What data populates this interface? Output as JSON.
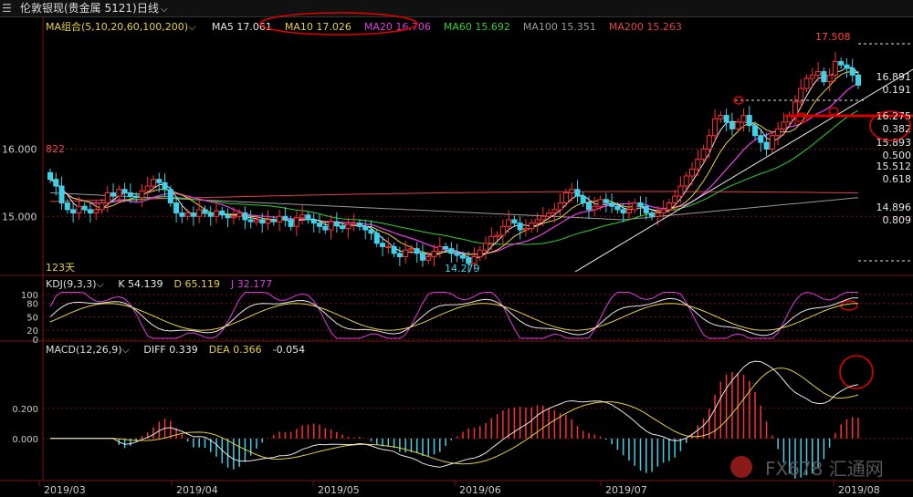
{
  "window": {
    "symbol": "伦敦银现(贵金属 5121)",
    "period": "日线",
    "menu_icon": "menu-lines-icon",
    "dropdown_icon": "chevron-down-icon"
  },
  "ma_bar": {
    "group_label": "MA组合(5,10,20,60,100,200)",
    "items": [
      {
        "label": "MA5 17.061",
        "color": "#e8e8e8"
      },
      {
        "label": "MA10 17.026",
        "color": "#e6d23a"
      },
      {
        "label": "MA20 16.706",
        "color": "#e03ae0"
      },
      {
        "label": "MA60 15.692",
        "color": "#2ed12e"
      },
      {
        "label": "MA100 15.351",
        "color": "#9a9a9a"
      },
      {
        "label": "MA200 15.263",
        "color": "#e84040"
      }
    ]
  },
  "kdj_bar": {
    "label": "KDJ(9,3,3)",
    "items": [
      {
        "label": "K 54.139",
        "color": "#e8e8e8"
      },
      {
        "label": "D 65.119",
        "color": "#e6d23a"
      },
      {
        "label": "J 32.177",
        "color": "#e03ae0"
      }
    ]
  },
  "macd_bar": {
    "label": "MACD(12,26,9)",
    "items": [
      {
        "label": "DIFF 0.339",
        "color": "#e8e8e8"
      },
      {
        "label": "DEA 0.366",
        "color": "#e6d23a"
      },
      {
        "label": "-0.054",
        "color": "#e8e8e8"
      }
    ]
  },
  "price_axis": [
    "16.000",
    "15.000"
  ],
  "kdj_axis": [
    "100",
    "80",
    "50",
    "20",
    "0"
  ],
  "macd_axis": [
    "0.200",
    "0.000"
  ],
  "x_labels": [
    "2019/03",
    "2019/04",
    "2019/05",
    "2019/06",
    "2019/07",
    "2019/08"
  ],
  "annotations": {
    "high": "17.508",
    "low": "14.279",
    "left_mark": "822",
    "days": "123天"
  },
  "fib_levels": [
    {
      "price": "16.891",
      "ratio": "0.191"
    },
    {
      "price": "16.275",
      "ratio": "0.382"
    },
    {
      "price": "15.893",
      "ratio": "0.500"
    },
    {
      "price": "15.512",
      "ratio": "0.618"
    },
    {
      "price": "14.896",
      "ratio": "0.809"
    }
  ],
  "watermark": "FX678 汇通网",
  "colors": {
    "up": "#ff3030",
    "down": "#40d0e8",
    "grid": "#7a1414",
    "highlight": "#e00000"
  },
  "chart_data": {
    "type": "candlestick",
    "start": "2019-03-01",
    "open": [
      15.65,
      15.55,
      15.45,
      15.2,
      15.1,
      15.05,
      15.15,
      15.1,
      15.05,
      15.1,
      15.2,
      15.35,
      15.3,
      15.4,
      15.35,
      15.3,
      15.28,
      15.38,
      15.45,
      15.55,
      15.5,
      15.4,
      15.2,
      15.05,
      15.0,
      15.05,
      15.0,
      15.1,
      15.05,
      15.0,
      15.08,
      15.02,
      14.98,
      15.0,
      15.05,
      14.95,
      14.92,
      14.95,
      14.9,
      14.95,
      14.92,
      15.0,
      14.95,
      14.85,
      14.98,
      15.02,
      14.95,
      14.9,
      14.85,
      14.8,
      14.92,
      14.86,
      14.82,
      14.88,
      14.9,
      14.85,
      14.8,
      14.75,
      14.6,
      14.55,
      14.55,
      14.45,
      14.4,
      14.5,
      14.52,
      14.45,
      14.35,
      14.4,
      14.48,
      14.55,
      14.52,
      14.45,
      14.42,
      14.38,
      14.3,
      14.4,
      14.5,
      14.6,
      14.7,
      14.72,
      14.85,
      14.95,
      14.9,
      14.8,
      14.82,
      14.9,
      14.95,
      15.0,
      15.05,
      15.1,
      15.2,
      15.35,
      15.4,
      15.3,
      15.2,
      15.1,
      15.15,
      15.25,
      15.2,
      15.15,
      15.1,
      15.05,
      15.1,
      15.2,
      15.15,
      15.05,
      15.0,
      15.05,
      15.1,
      15.2,
      15.3,
      15.45,
      15.6,
      15.7,
      15.85,
      16.0,
      16.2,
      16.45,
      16.5,
      16.4,
      16.3,
      16.4,
      16.5,
      16.35,
      16.2,
      16.1,
      16.0,
      16.2,
      16.3,
      16.4,
      16.5,
      16.7,
      16.9,
      17.05,
      17.1,
      17.15,
      17.0,
      17.1,
      17.3,
      17.25,
      17.2,
      17.1
    ],
    "close": [
      15.55,
      15.45,
      15.2,
      15.1,
      15.05,
      15.15,
      15.1,
      15.05,
      15.1,
      15.2,
      15.35,
      15.3,
      15.4,
      15.35,
      15.3,
      15.28,
      15.38,
      15.45,
      15.55,
      15.5,
      15.4,
      15.2,
      15.05,
      15.0,
      15.05,
      15.0,
      15.1,
      15.05,
      15.0,
      15.08,
      15.02,
      14.98,
      15.0,
      15.05,
      14.95,
      14.92,
      14.95,
      14.9,
      14.95,
      14.92,
      15.0,
      14.95,
      14.85,
      14.98,
      15.02,
      14.95,
      14.9,
      14.85,
      14.8,
      14.92,
      14.86,
      14.82,
      14.88,
      14.9,
      14.85,
      14.8,
      14.75,
      14.6,
      14.55,
      14.55,
      14.45,
      14.4,
      14.5,
      14.52,
      14.45,
      14.35,
      14.4,
      14.48,
      14.55,
      14.52,
      14.45,
      14.42,
      14.38,
      14.3,
      14.4,
      14.5,
      14.6,
      14.7,
      14.72,
      14.85,
      14.95,
      14.9,
      14.8,
      14.82,
      14.9,
      14.95,
      15.0,
      15.05,
      15.1,
      15.2,
      15.35,
      15.4,
      15.3,
      15.2,
      15.1,
      15.15,
      15.25,
      15.2,
      15.15,
      15.1,
      15.05,
      15.1,
      15.2,
      15.15,
      15.05,
      15.0,
      15.05,
      15.1,
      15.2,
      15.3,
      15.45,
      15.6,
      15.7,
      15.85,
      16.0,
      16.2,
      16.45,
      16.5,
      16.4,
      16.3,
      16.4,
      16.5,
      16.35,
      16.2,
      16.1,
      16.0,
      16.2,
      16.3,
      16.4,
      16.5,
      16.7,
      16.9,
      17.05,
      17.1,
      17.15,
      17.0,
      17.1,
      17.3,
      17.25,
      17.2,
      17.1,
      16.95
    ],
    "price_ylim": [
      14.15,
      17.7
    ],
    "kdj_ylim": [
      0,
      110
    ],
    "macd_ylim": [
      -0.28,
      0.55
    ]
  }
}
